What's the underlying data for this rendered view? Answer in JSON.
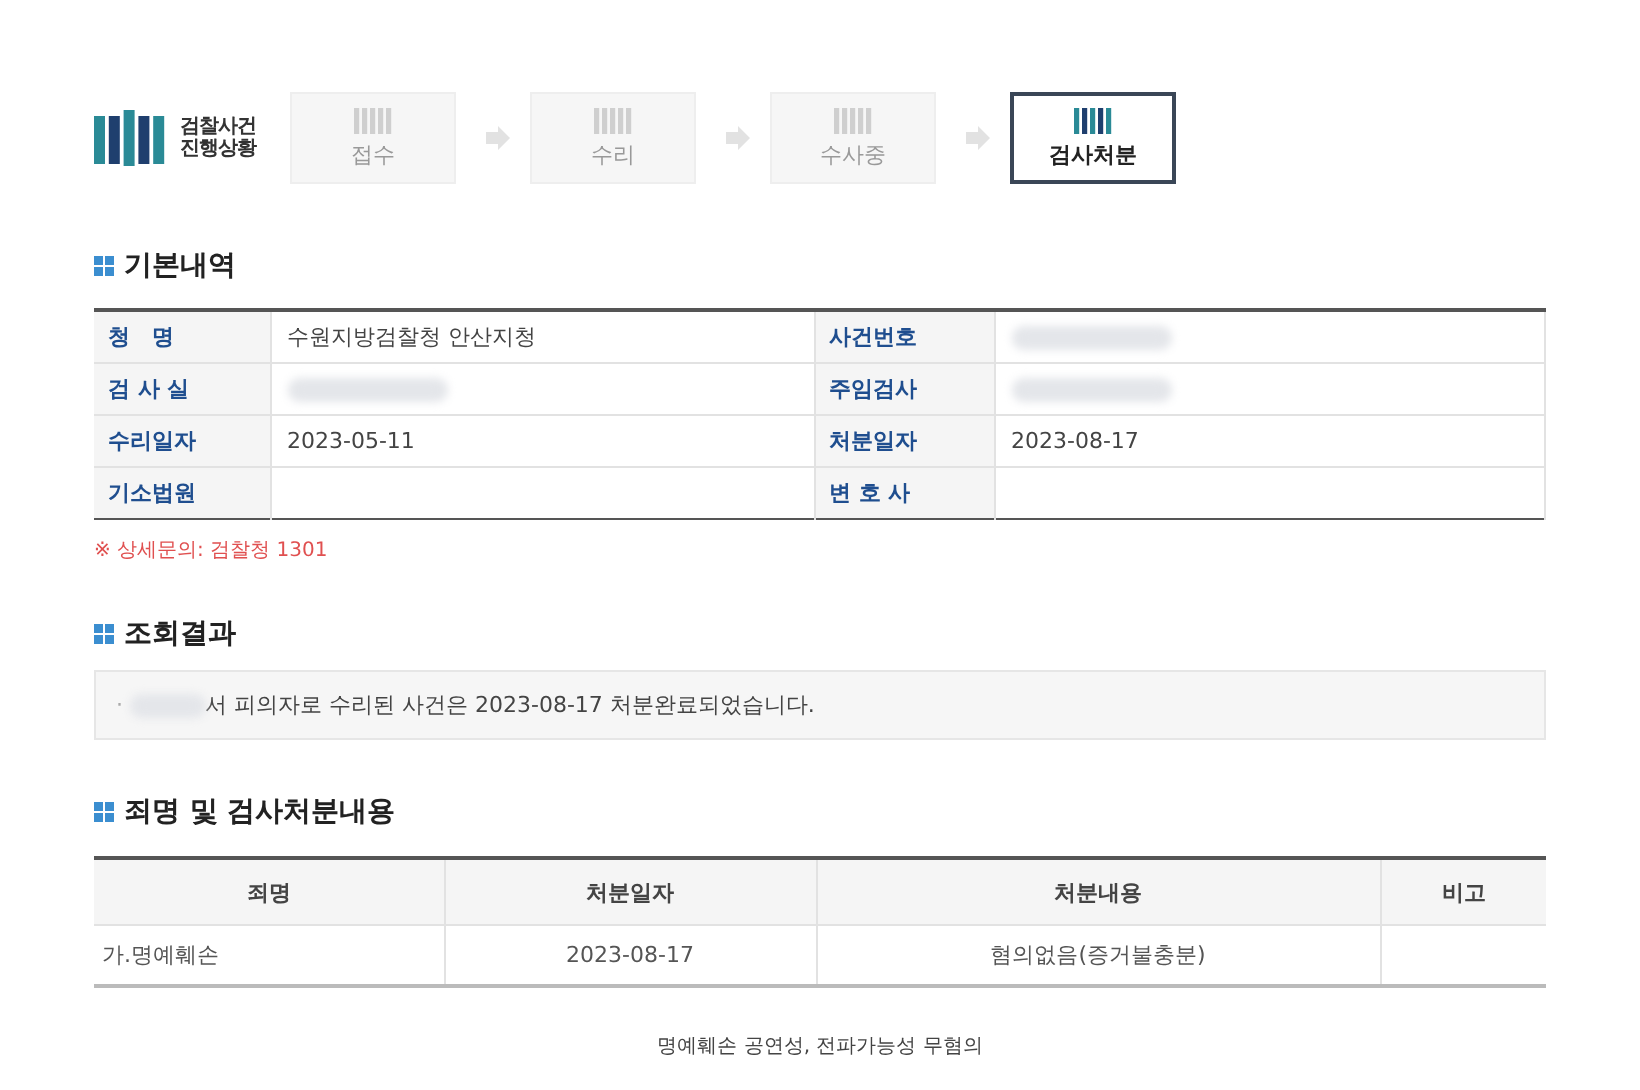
{
  "logo": {
    "line1": "검찰사건",
    "line2": "진행상황"
  },
  "steps": [
    {
      "label": "접수",
      "selected": false
    },
    {
      "label": "수리",
      "selected": false
    },
    {
      "label": "수사중",
      "selected": false
    },
    {
      "label": "검사처분",
      "selected": true
    }
  ],
  "basic": {
    "title": "기본내역",
    "rows": [
      {
        "label1": "청　명",
        "value1": "수원지방검찰청 안산지청",
        "redacted1": false,
        "label2": "사건번호",
        "value2": "",
        "redacted2": true
      },
      {
        "label1": "검 사 실",
        "value1": "",
        "redacted1": true,
        "label2": "주임검사",
        "value2": "",
        "redacted2": true
      },
      {
        "label1": "수리일자",
        "value1": "2023-05-11",
        "redacted1": false,
        "label2": "처분일자",
        "value2": "2023-08-17",
        "redacted2": false
      },
      {
        "label1": "기소법원",
        "value1": "",
        "redacted1": false,
        "label2": "변 호 사",
        "value2": "",
        "redacted2": false
      }
    ],
    "note": "※ 상세문의: 검찰청 1301"
  },
  "result": {
    "title": "조회결과",
    "bullet": "·",
    "name_redacted": true,
    "text": "서 피의자로 수리된 사건은 2023-08-17 처분완료되었습니다."
  },
  "charges": {
    "title": "죄명 및 검사처분내용",
    "columns": [
      "죄명",
      "처분일자",
      "처분내용",
      "비고"
    ],
    "rows": [
      [
        "가.명예훼손",
        "2023-08-17",
        "혐의없음(증거불충분)",
        ""
      ]
    ],
    "footnote": "명예훼손 공연성, 전파가능성 무혐의"
  }
}
